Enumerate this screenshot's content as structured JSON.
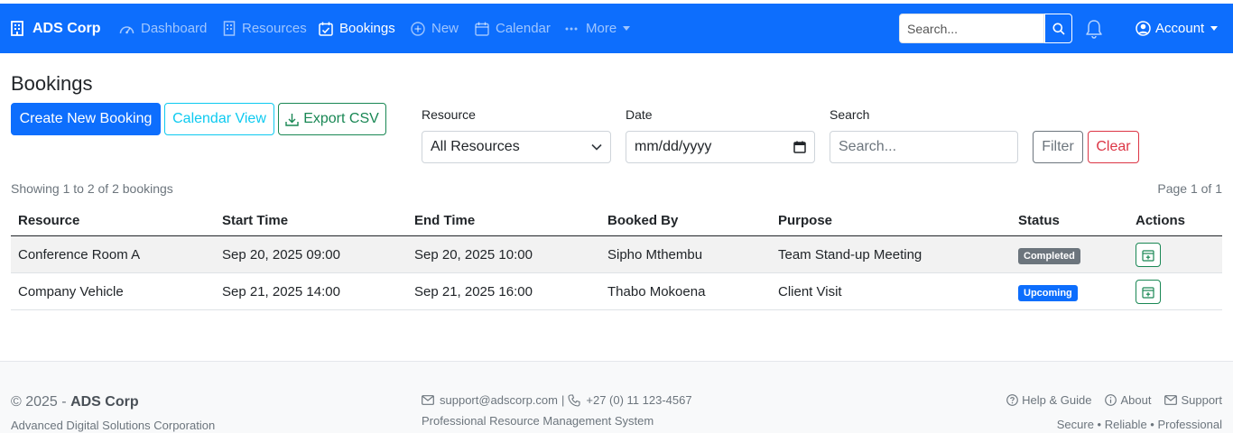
{
  "navbar": {
    "brand": "ADS Corp",
    "items": [
      {
        "label": "Dashboard",
        "icon": "speedometer-icon"
      },
      {
        "label": "Resources",
        "icon": "building-icon"
      },
      {
        "label": "Bookings",
        "icon": "calendar-check-icon"
      },
      {
        "label": "New",
        "icon": "plus-circle-icon"
      },
      {
        "label": "Calendar",
        "icon": "calendar-icon"
      },
      {
        "label": "More",
        "icon": "three-dots-icon"
      }
    ],
    "active": "Bookings",
    "search_placeholder": "Search...",
    "account_label": "Account"
  },
  "page": {
    "title": "Bookings",
    "create_button": "Create New Booking",
    "calendar_button": "Calendar View",
    "export_button": "Export CSV"
  },
  "filters": {
    "resource_label": "Resource",
    "resource_value": "All Resources",
    "date_label": "Date",
    "date_value": "mm/dd/yyyy",
    "search_label": "Search",
    "search_placeholder": "Search...",
    "filter_button": "Filter",
    "clear_button": "Clear"
  },
  "summary": {
    "showing": "Showing 1 to 2 of 2 bookings",
    "page": "Page 1 of 1"
  },
  "table": {
    "headers": [
      "Resource",
      "Start Time",
      "End Time",
      "Booked By",
      "Purpose",
      "Status",
      "Actions"
    ],
    "rows": [
      {
        "resource": "Conference Room A",
        "start": "Sep 20, 2025 09:00",
        "end": "Sep 20, 2025 10:00",
        "booked_by": "Sipho Mthembu",
        "purpose": "Team Stand-up Meeting",
        "status": "Completed"
      },
      {
        "resource": "Company Vehicle",
        "start": "Sep 21, 2025 14:00",
        "end": "Sep 21, 2025 16:00",
        "booked_by": "Thabo Mokoena",
        "purpose": "Client Visit",
        "status": "Upcoming"
      }
    ]
  },
  "footer": {
    "copyright_prefix": "© 2025 -",
    "company": "ADS Corp",
    "org": "Advanced Digital Solutions Corporation",
    "email": "support@adscorp.com",
    "separator": "|",
    "phone": "+27 (0) 11 123-4567",
    "system": "Professional Resource Management System",
    "links": [
      "Help & Guide",
      "About",
      "Support"
    ],
    "tagline": "Secure • Reliable • Professional"
  },
  "colors": {
    "primary": "#0d6efd",
    "info": "#0dcaf0",
    "success": "#198754",
    "danger": "#dc3545",
    "secondary": "#6c757d"
  }
}
